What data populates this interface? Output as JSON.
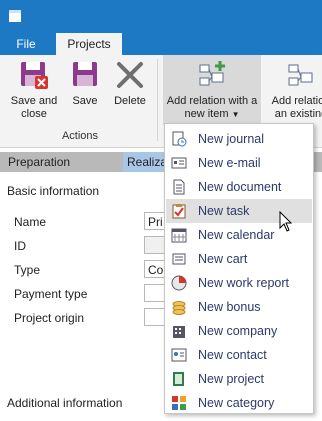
{
  "ribbon": {
    "tabs": [
      {
        "label": "File"
      },
      {
        "label": "Projects"
      }
    ],
    "buttons": {
      "save_and_close": "Save and close",
      "save": "Save",
      "delete": "Delete",
      "add_new": "Add relation with a new item",
      "add_existing": "Add relation an existing"
    },
    "group_label": "Actions"
  },
  "sections": {
    "preparation": "Preparation",
    "realization": "Realiza"
  },
  "form": {
    "heading": "Basic information",
    "fields": [
      {
        "label": "Name",
        "value": "Pri"
      },
      {
        "label": "ID",
        "value": ""
      },
      {
        "label": "Type",
        "value": "Co"
      },
      {
        "label": "Payment type",
        "value": ""
      },
      {
        "label": "Project origin",
        "value": ""
      }
    ],
    "heading2": "Additional information"
  },
  "menu": {
    "items": [
      {
        "label": "New journal",
        "icon": "journal-icon"
      },
      {
        "label": "New e-mail",
        "icon": "email-icon"
      },
      {
        "label": "New document",
        "icon": "document-icon"
      },
      {
        "label": "New task",
        "icon": "task-icon",
        "hover": true
      },
      {
        "label": "New calendar",
        "icon": "calendar-icon"
      },
      {
        "label": "New cart",
        "icon": "cart-icon"
      },
      {
        "label": "New work report",
        "icon": "work-report-icon"
      },
      {
        "label": "New bonus",
        "icon": "bonus-icon"
      },
      {
        "label": "New company",
        "icon": "company-icon"
      },
      {
        "label": "New contact",
        "icon": "contact-icon"
      },
      {
        "label": "New project",
        "icon": "project-icon"
      },
      {
        "label": "New category",
        "icon": "category-icon"
      }
    ]
  },
  "colors": {
    "titlebar": "#1e79c4",
    "ribbon_bg": "#f3f3f3",
    "menu_text": "#2a3a6a",
    "hover": "#e0e0e0"
  }
}
